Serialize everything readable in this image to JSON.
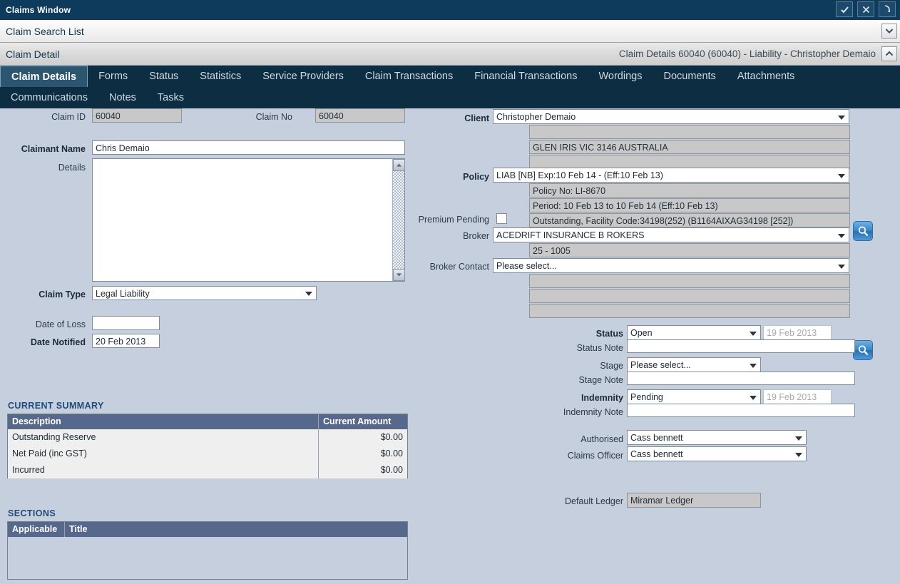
{
  "window": {
    "title": "Claims Window",
    "buttons": [
      {
        "name": "confirm",
        "icon": "check-icon"
      },
      {
        "name": "close",
        "icon": "close-icon"
      },
      {
        "name": "restore",
        "icon": "undo-arrow-icon"
      }
    ]
  },
  "breadcrumbs": {
    "search_list": "Claim Search List",
    "detail": "Claim Detail",
    "detail_summary": "Claim Details 60040 (60040) - Liability - Christopher Demaio"
  },
  "tabs": {
    "row1": [
      {
        "label": "Claim Details",
        "active": true
      },
      {
        "label": "Forms",
        "active": false
      },
      {
        "label": "Status",
        "active": false
      },
      {
        "label": "Statistics",
        "active": false
      },
      {
        "label": "Service Providers",
        "active": false
      },
      {
        "label": "Claim Transactions",
        "active": false
      },
      {
        "label": "Financial Transactions",
        "active": false
      },
      {
        "label": "Wordings",
        "active": false
      },
      {
        "label": "Documents",
        "active": false
      },
      {
        "label": "Attachments",
        "active": false
      }
    ],
    "row2": [
      {
        "label": "Communications",
        "active": false
      },
      {
        "label": "Notes",
        "active": false
      },
      {
        "label": "Tasks",
        "active": false
      }
    ]
  },
  "left": {
    "claim_id_label": "Claim ID",
    "claim_id_value": "60040",
    "claim_no_label": "Claim No",
    "claim_no_value": "60040",
    "claimant_name_label": "Claimant Name",
    "claimant_name_value": "Chris Demaio",
    "details_label": "Details",
    "details_value": "",
    "claim_type_label": "Claim Type",
    "claim_type_value": "Legal Liability",
    "date_of_loss_label": "Date of Loss",
    "date_of_loss_value": "",
    "date_notified_label": "Date Notified",
    "date_notified_value": "20 Feb 2013"
  },
  "current_summary": {
    "heading": "CURRENT SUMMARY",
    "columns": [
      "Description",
      "Current Amount"
    ],
    "rows": [
      {
        "description": "Outstanding Reserve",
        "amount": "$0.00"
      },
      {
        "description": "Net Paid (inc GST)",
        "amount": "$0.00"
      },
      {
        "description": "Incurred",
        "amount": "$0.00"
      }
    ]
  },
  "sections": {
    "heading": "SECTIONS",
    "columns": [
      "Applicable",
      "Title"
    ],
    "rows": []
  },
  "right": {
    "client_label": "Client",
    "client_value": "Christopher Demaio",
    "client_line1": "",
    "client_line2": "GLEN IRIS VIC 3146 AUSTRALIA",
    "client_line3": "",
    "policy_label": "Policy",
    "policy_value": "LIAB [NB] Exp:10 Feb 14 -  (Eff:10 Feb 13)",
    "policy_no": "Policy No: LI-8670",
    "policy_period": "Period: 10 Feb 13 to 10 Feb 14 (Eff:10 Feb 13)",
    "policy_outstanding": "Outstanding, Facility Code:34198(252) (B1164AIXAG34198 [252])",
    "premium_pending_label": "Premium Pending",
    "premium_pending_checked": false,
    "broker_label": "Broker",
    "broker_value": "ACEDRIFT INSURANCE B ROKERS",
    "broker_code": "25 - 1005",
    "broker_contact_label": "Broker Contact",
    "broker_contact_value": "Please select...",
    "broker_line1": "",
    "broker_line2": "",
    "broker_line3": ""
  },
  "status_block": {
    "status_label": "Status",
    "status_value": "Open",
    "status_date": "19 Feb 2013",
    "status_note_label": "Status Note",
    "status_note_value": "",
    "stage_label": "Stage",
    "stage_value": "Please select...",
    "stage_note_label": "Stage Note",
    "stage_note_value": "",
    "indemnity_label": "Indemnity",
    "indemnity_value": "Pending",
    "indemnity_date": "19 Feb 2013",
    "indemnity_note_label": "Indemnity Note",
    "indemnity_note_value": "",
    "authorised_label": "Authorised",
    "authorised_value": "Cass bennett",
    "claims_officer_label": "Claims Officer",
    "claims_officer_value": "Cass bennett",
    "default_ledger_label": "Default Ledger",
    "default_ledger_value": "Miramar Ledger"
  },
  "colors": {
    "titlebar": "#0e3b5c",
    "tabstrip": "#0c2d42",
    "active_tab": "#2c5570",
    "page_bg": "#c6cfdd",
    "grid_header": "#56688c",
    "section_heading": "#1f4b79",
    "readonly_field": "#c8c8c8"
  }
}
